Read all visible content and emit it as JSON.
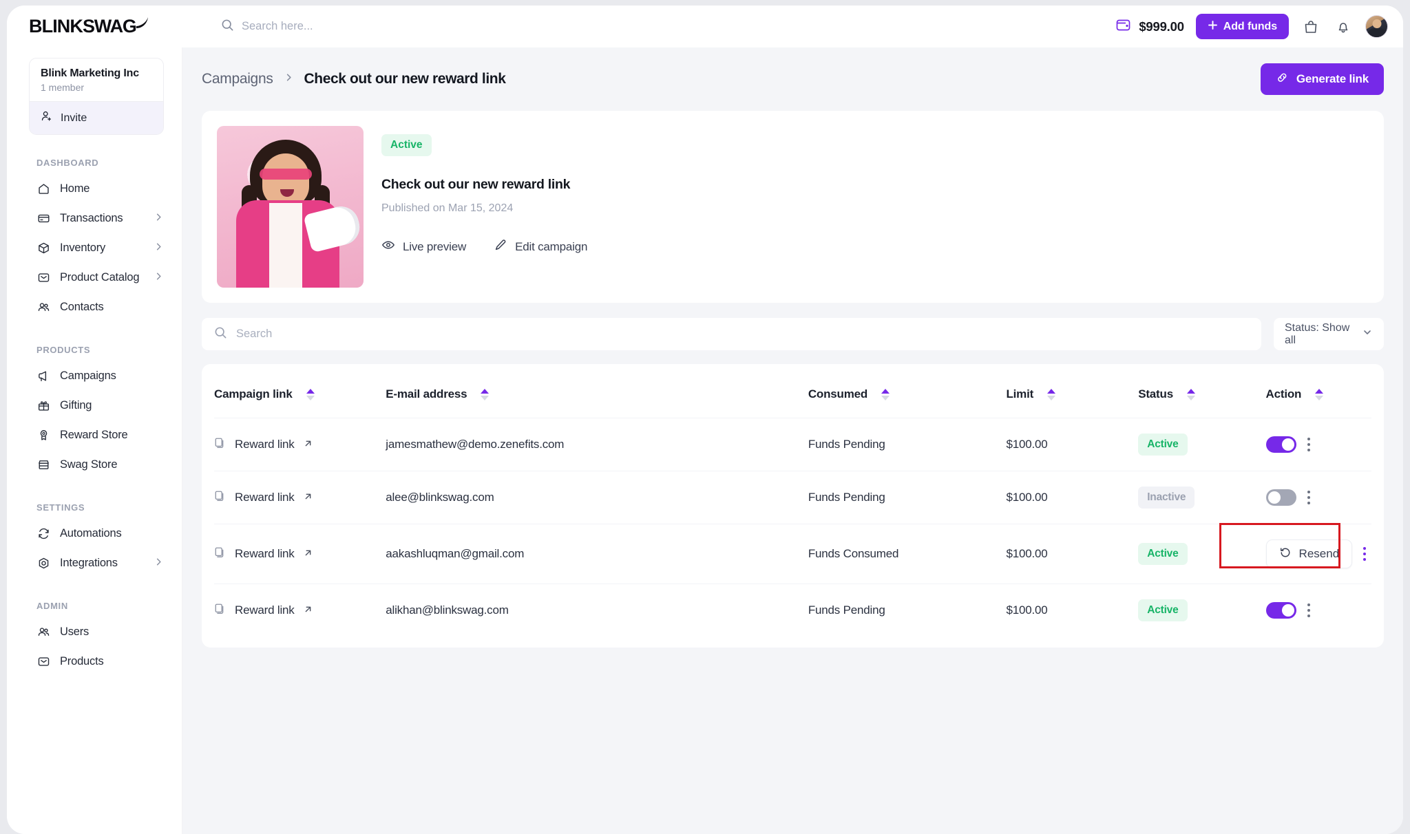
{
  "brand": {
    "name_part1": "BLINK",
    "name_part2": "SWAG"
  },
  "topbar": {
    "search_placeholder": "Search here...",
    "balance": "$999.00",
    "add_funds_label": "Add funds",
    "wallet_icon": "wallet-icon",
    "bag_icon": "bag-icon",
    "bell_icon": "bell-icon",
    "avatar_icon": "user-avatar"
  },
  "sidebar": {
    "org": {
      "name": "Blink Marketing Inc",
      "members": "1 member",
      "invite_label": "Invite"
    },
    "sections": [
      {
        "title": "DASHBOARD",
        "items": [
          {
            "label": "Home",
            "icon": "home-icon",
            "chevron": false
          },
          {
            "label": "Transactions",
            "icon": "card-icon",
            "chevron": true
          },
          {
            "label": "Inventory",
            "icon": "box-icon",
            "chevron": true
          },
          {
            "label": "Product Catalog",
            "icon": "catalog-icon",
            "chevron": true
          },
          {
            "label": "Contacts",
            "icon": "contacts-icon",
            "chevron": false
          }
        ]
      },
      {
        "title": "PRODUCTS",
        "items": [
          {
            "label": "Campaigns",
            "icon": "megaphone-icon",
            "chevron": false
          },
          {
            "label": "Gifting",
            "icon": "gift-icon",
            "chevron": false
          },
          {
            "label": "Reward Store",
            "icon": "medal-icon",
            "chevron": false
          },
          {
            "label": "Swag Store",
            "icon": "store-icon",
            "chevron": false
          }
        ]
      },
      {
        "title": "SETTINGS",
        "items": [
          {
            "label": "Automations",
            "icon": "refresh-icon",
            "chevron": false
          },
          {
            "label": "Integrations",
            "icon": "hexagon-icon",
            "chevron": true
          }
        ]
      },
      {
        "title": "ADMIN",
        "items": [
          {
            "label": "Users",
            "icon": "contacts-icon",
            "chevron": false
          },
          {
            "label": "Products",
            "icon": "catalog-icon",
            "chevron": false
          }
        ]
      }
    ]
  },
  "page": {
    "breadcrumb_root": "Campaigns",
    "breadcrumb_current": "Check out our new reward link",
    "generate_link_label": "Generate link",
    "generate_link_icon": "link-icon"
  },
  "campaign": {
    "status_badge": "Active",
    "title": "Check out our new reward link",
    "published": "Published on Mar 15, 2024",
    "live_preview_label": "Live preview",
    "live_preview_icon": "eye-icon",
    "edit_label": "Edit campaign",
    "edit_icon": "pencil-icon"
  },
  "filters": {
    "search_placeholder": "Search",
    "status_label": "Status: Show all",
    "chevron_icon": "chevron-down-icon"
  },
  "table": {
    "columns": [
      {
        "label": "Campaign link",
        "sortable": true
      },
      {
        "label": "E-mail address",
        "sortable": true
      },
      {
        "label": "Consumed",
        "sortable": true
      },
      {
        "label": "Limit",
        "sortable": true
      },
      {
        "label": "Status",
        "sortable": true
      },
      {
        "label": "Action",
        "sortable": true
      }
    ],
    "link_label": "Reward link",
    "rows": [
      {
        "link": "Reward link",
        "email": "jamesmathew@demo.zenefits.com",
        "consumed": "Funds Pending",
        "limit": "$100.00",
        "status": "Active",
        "status_type": "active",
        "action": "toggle",
        "toggle_on": true
      },
      {
        "link": "Reward link",
        "email": "alee@blinkswag.com",
        "consumed": "Funds Pending",
        "limit": "$100.00",
        "status": "Inactive",
        "status_type": "inactive",
        "action": "toggle",
        "toggle_on": false
      },
      {
        "link": "Reward link",
        "email": "aakashluqman@gmail.com",
        "consumed": "Funds Consumed",
        "limit": "$100.00",
        "status": "Active",
        "status_type": "active",
        "action": "resend",
        "resend_label": "Resend",
        "highlighted": true
      },
      {
        "link": "Reward link",
        "email": "alikhan@blinkswag.com",
        "consumed": "Funds Pending",
        "limit": "$100.00",
        "status": "Active",
        "status_type": "active",
        "action": "toggle",
        "toggle_on": true
      }
    ]
  },
  "colors": {
    "accent": "#7629e8",
    "active_text": "#17b467",
    "active_bg": "#e6f8ee",
    "inactive_text": "#9ba1b0",
    "inactive_bg": "#f1f2f6",
    "highlight_border": "#d71920",
    "page_bg": "#f4f5f8"
  }
}
